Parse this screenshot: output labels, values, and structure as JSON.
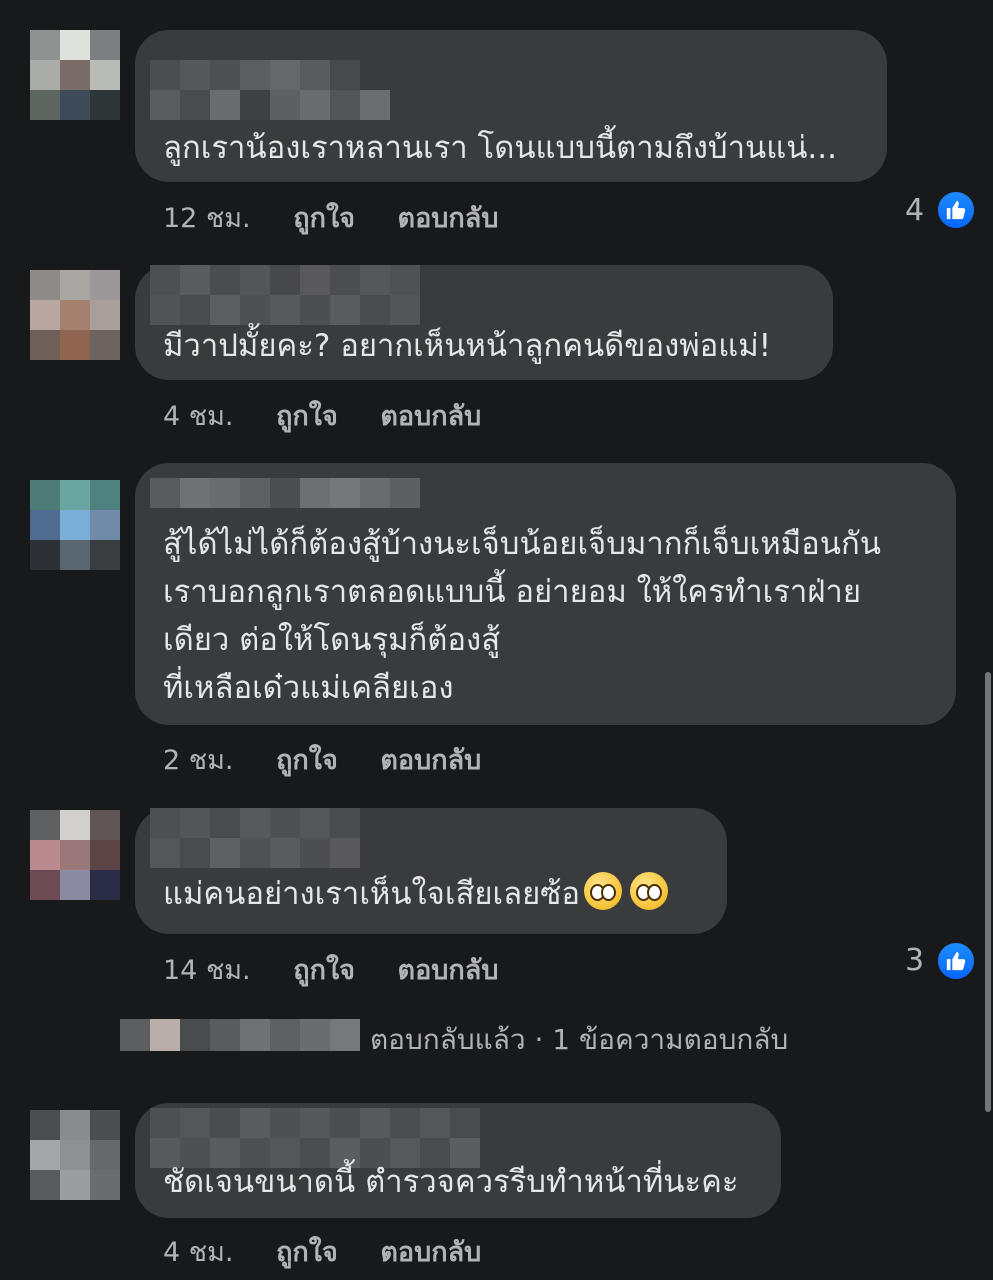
{
  "comments": [
    {
      "text_lines": [
        "ลูกเราน้องเราหลานเรา โดนแบบนี้ตามถึงบ้านแน่..."
      ],
      "time": "12 ชม.",
      "like_label": "ถูกใจ",
      "reply_label": "ตอบกลับ",
      "reaction_count": "4"
    },
    {
      "text_lines": [
        "มีวาปมั้ยคะ? อยากเห็นหน้าลูกคนดีของพ่อแม่!"
      ],
      "time": "4 ชม.",
      "like_label": "ถูกใจ",
      "reply_label": "ตอบกลับ"
    },
    {
      "text_lines": [
        "สู้ได้ไม่ได้ก็ต้องสู้บ้างนะเจ็บน้อยเจ็บมากก็เจ็บเหมือนกัน",
        "เราบอกลูกเราตลอดแบบนี้ อย่ายอม ให้ใครทำเราฝ่าย",
        "เดียว ต่อให้โดนรุมก็ต้องสู้",
        "ที่เหลือเด๋วแม่เคลียเอง"
      ],
      "time": "2 ชม.",
      "like_label": "ถูกใจ",
      "reply_label": "ตอบกลับ"
    },
    {
      "text_lines": [
        "แม่คนอย่างเราเห็นใจเสียเลยซ้อ"
      ],
      "emoji": [
        "pleading-face-emoji",
        "pleading-face-emoji"
      ],
      "time": "14 ชม.",
      "like_label": "ถูกใจ",
      "reply_label": "ตอบกลับ",
      "reaction_count": "3",
      "reply_summary": "ตอบกลับแล้ว · 1 ข้อความตอบกลับ"
    },
    {
      "text_lines": [
        "ชัดเจนขนาดนี้ ตำรวจควรรีบทำหน้าที่นะคะ"
      ],
      "time": "4 ชม.",
      "like_label": "ถูกใจ",
      "reply_label": "ตอบกลับ"
    }
  ],
  "colors": {
    "background": "#18191a",
    "bubble": "#3a3b3c",
    "text": "#e4e6eb",
    "meta": "#b0b3b8",
    "like_blue": "#0866ff"
  }
}
